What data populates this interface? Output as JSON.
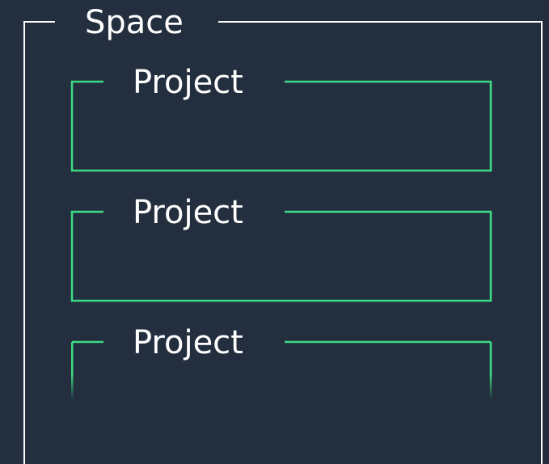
{
  "space": {
    "label": "Space",
    "border_color": "#ffffff"
  },
  "projects": [
    {
      "label": "Project"
    },
    {
      "label": "Project"
    },
    {
      "label": "Project"
    }
  ],
  "colors": {
    "background": "#232f3e",
    "project_border": "#3ddc84",
    "label_text": "#ffffff"
  }
}
